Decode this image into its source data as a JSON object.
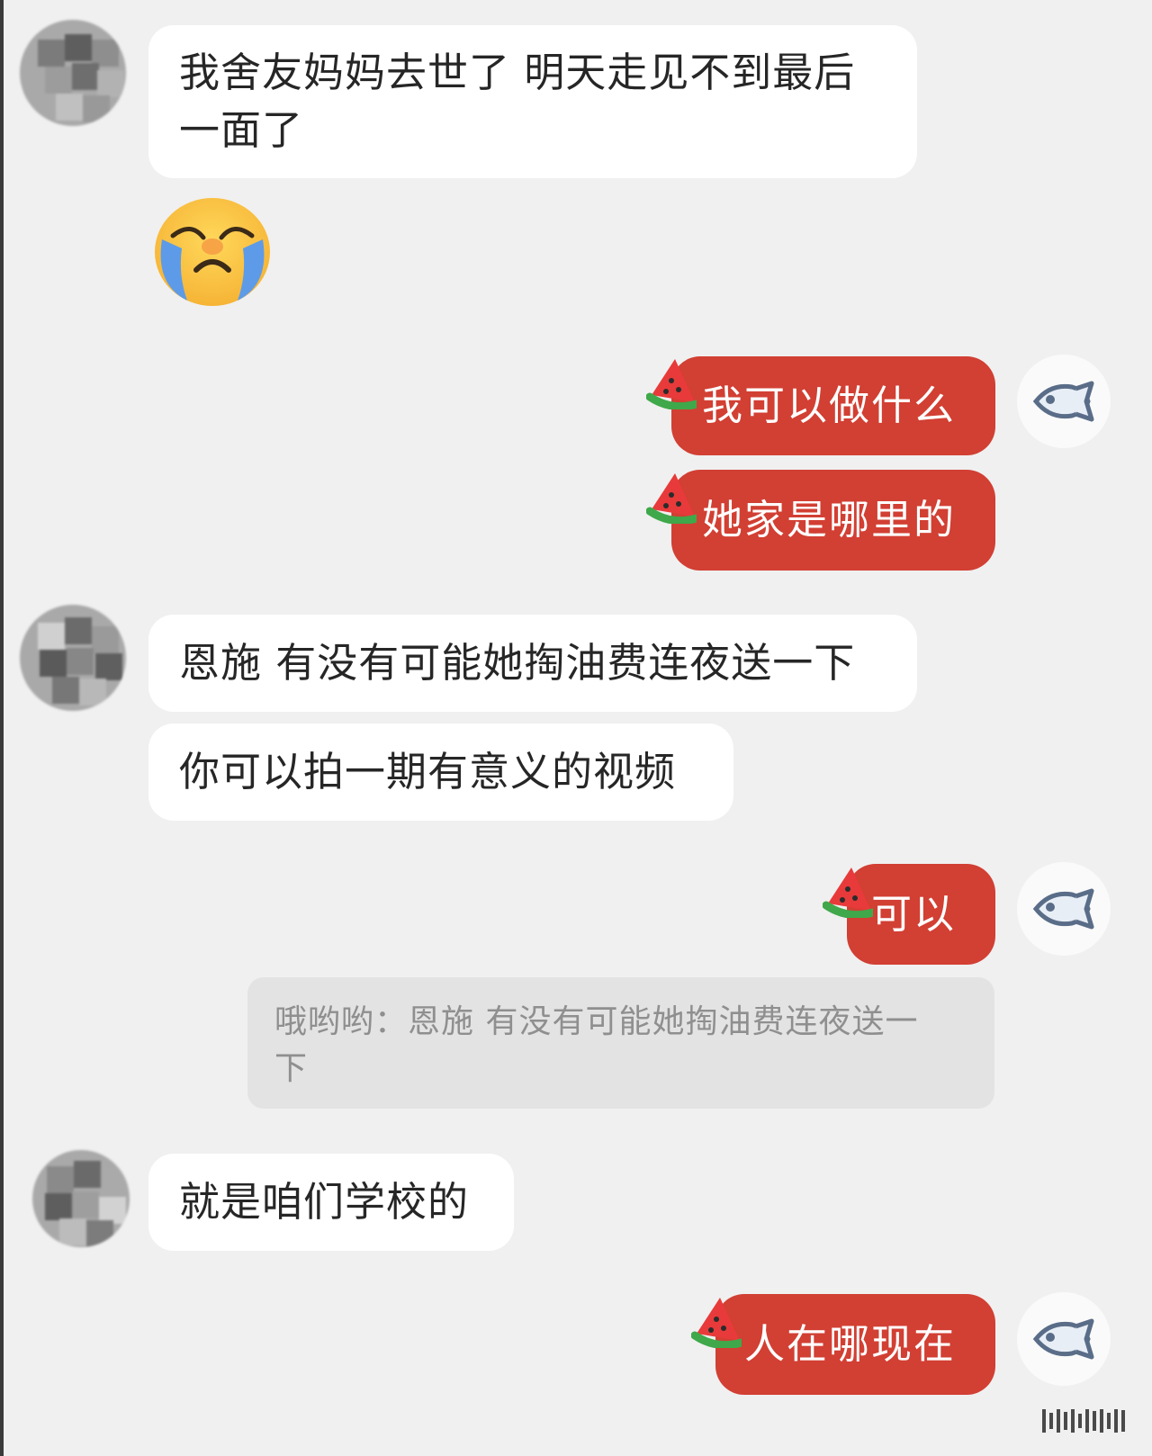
{
  "messages": [
    {
      "side": "in",
      "type": "text",
      "lines": [
        "我舍友妈妈去世了 明天走见不到最后",
        "一面了"
      ]
    },
    {
      "side": "in",
      "type": "sticker",
      "sticker": "crying-face"
    },
    {
      "side": "out",
      "type": "text",
      "text": "我可以做什么"
    },
    {
      "side": "out",
      "type": "text",
      "text": "她家是哪里的"
    },
    {
      "side": "in",
      "type": "text",
      "text": "恩施 有没有可能她掏油费连夜送一下"
    },
    {
      "side": "in",
      "type": "text",
      "text": "你可以拍一期有意义的视频"
    },
    {
      "side": "out",
      "type": "text",
      "text": "可以"
    },
    {
      "side": "out",
      "type": "quote",
      "lines": [
        "哦哟哟：恩施 有没有可能她掏油费连夜送一",
        "下"
      ]
    },
    {
      "side": "in",
      "type": "text",
      "text": "就是咱们学校的"
    },
    {
      "side": "out",
      "type": "text",
      "text": "人在哪现在"
    }
  ],
  "icons": {
    "sender_avatar": "blurred-avatar",
    "my_avatar": "fish-icon",
    "bubble_decoration": "watermelon-icon",
    "sticker": "crying-face-icon"
  },
  "colors": {
    "background": "#f0f0f0",
    "incoming_bubble": "#ffffff",
    "outgoing_bubble": "#d23f33",
    "quote_bg": "#e3e3e3",
    "fish": "#5a6d88"
  }
}
